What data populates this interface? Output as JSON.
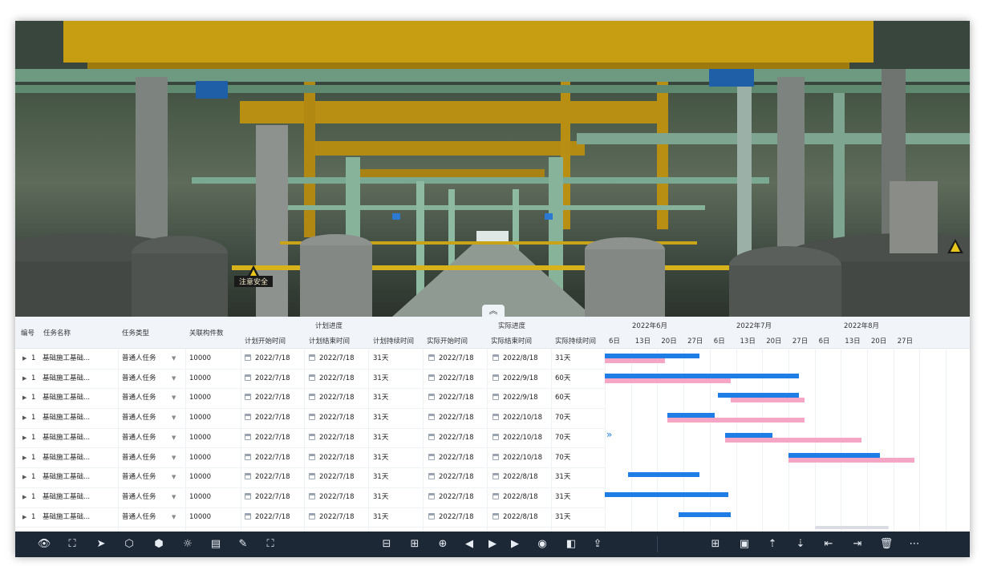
{
  "viewport": {
    "sign_text": "注意安全",
    "collapse_label": "︽"
  },
  "table": {
    "headers": {
      "id": "编号",
      "name": "任务名称",
      "type": "任务类型",
      "component": "关联构件数",
      "plan_group": "计划进度",
      "plan_start": "计划开始时间",
      "plan_end": "计划结束时间",
      "plan_duration": "计划持续时间",
      "actual_group": "实际进度",
      "actual_start": "实际开始时间",
      "actual_end": "实际结束时间",
      "actual_duration": "实际持续时间"
    },
    "rows": [
      {
        "id": "1",
        "name": "基础施工基础...",
        "type": "普通人任务",
        "component": "10000",
        "plan_start": "2022/7/18",
        "plan_end": "2022/7/18",
        "plan_duration": "31天",
        "actual_start": "2022/7/18",
        "actual_end": "2022/8/18",
        "actual_duration": "31天"
      },
      {
        "id": "1",
        "name": "基础施工基础...",
        "type": "普通人任务",
        "component": "10000",
        "plan_start": "2022/7/18",
        "plan_end": "2022/7/18",
        "plan_duration": "31天",
        "actual_start": "2022/7/18",
        "actual_end": "2022/9/18",
        "actual_duration": "60天"
      },
      {
        "id": "1",
        "name": "基础施工基础...",
        "type": "普通人任务",
        "component": "10000",
        "plan_start": "2022/7/18",
        "plan_end": "2022/7/18",
        "plan_duration": "31天",
        "actual_start": "2022/7/18",
        "actual_end": "2022/9/18",
        "actual_duration": "60天"
      },
      {
        "id": "1",
        "name": "基础施工基础...",
        "type": "普通人任务",
        "component": "10000",
        "plan_start": "2022/7/18",
        "plan_end": "2022/7/18",
        "plan_duration": "31天",
        "actual_start": "2022/7/18",
        "actual_end": "2022/10/18",
        "actual_duration": "70天"
      },
      {
        "id": "1",
        "name": "基础施工基础...",
        "type": "普通人任务",
        "component": "10000",
        "plan_start": "2022/7/18",
        "plan_end": "2022/7/18",
        "plan_duration": "31天",
        "actual_start": "2022/7/18",
        "actual_end": "2022/10/18",
        "actual_duration": "70天"
      },
      {
        "id": "1",
        "name": "基础施工基础...",
        "type": "普通人任务",
        "component": "10000",
        "plan_start": "2022/7/18",
        "plan_end": "2022/7/18",
        "plan_duration": "31天",
        "actual_start": "2022/7/18",
        "actual_end": "2022/10/18",
        "actual_duration": "70天"
      },
      {
        "id": "1",
        "name": "基础施工基础...",
        "type": "普通人任务",
        "component": "10000",
        "plan_start": "2022/7/18",
        "plan_end": "2022/7/18",
        "plan_duration": "31天",
        "actual_start": "2022/7/18",
        "actual_end": "2022/8/18",
        "actual_duration": "31天"
      },
      {
        "id": "1",
        "name": "基础施工基础...",
        "type": "普通人任务",
        "component": "10000",
        "plan_start": "2022/7/18",
        "plan_end": "2022/7/18",
        "plan_duration": "31天",
        "actual_start": "2022/7/18",
        "actual_end": "2022/8/18",
        "actual_duration": "31天"
      },
      {
        "id": "1",
        "name": "基础施工基础...",
        "type": "普通人任务",
        "component": "10000",
        "plan_start": "2022/7/18",
        "plan_end": "2022/7/18",
        "plan_duration": "31天",
        "actual_start": "2022/7/18",
        "actual_end": "2022/8/18",
        "actual_duration": "31天"
      }
    ]
  },
  "gantt": {
    "months": [
      "2022年6月",
      "2022年7月",
      "2022年8月"
    ],
    "days": [
      "6日",
      "13日",
      "20日",
      "27日",
      "6日",
      "13日",
      "20日",
      "27日",
      "6日",
      "13日",
      "20日",
      "27日"
    ],
    "plan_color": "#1e7ee6",
    "actual_color": "#f4a6c4",
    "bars": [
      {
        "plan": [
          0.0,
          3.6
        ],
        "actual": [
          0.0,
          2.3
        ]
      },
      {
        "plan": [
          0.0,
          7.4
        ],
        "actual": [
          0.0,
          4.8
        ]
      },
      {
        "plan": [
          4.3,
          7.4
        ],
        "actual": [
          4.8,
          7.6
        ]
      },
      {
        "plan": [
          2.4,
          4.2
        ],
        "actual": [
          2.4,
          7.6
        ]
      },
      {
        "plan": [
          4.6,
          6.4
        ],
        "actual": [
          4.6,
          9.8
        ]
      },
      {
        "plan": [
          7.0,
          10.5
        ],
        "actual": [
          7.0,
          11.8
        ]
      },
      {
        "plan": [
          0.9,
          3.6
        ],
        "actual": null
      },
      {
        "plan": [
          0.0,
          4.7
        ],
        "actual": null
      },
      {
        "plan": [
          2.8,
          4.8
        ],
        "actual": null
      }
    ]
  },
  "toolbar": {
    "left": [
      "eye-icon",
      "box-select-icon",
      "send-icon",
      "cube-icon",
      "cube-rotate-icon",
      "weather-icon",
      "building-icon",
      "document-edit-icon",
      "fullscreen-icon"
    ],
    "center": [
      "section-box-icon",
      "section-plane-icon",
      "globe-icon",
      "prev-icon",
      "play-icon",
      "next-icon",
      "camera-view-icon",
      "compare-icon",
      "export-icon"
    ],
    "right": [
      "add-icon",
      "add-child-icon",
      "move-up-icon",
      "move-down-icon",
      "outdent-icon",
      "indent-icon",
      "delete-icon",
      "more-icon"
    ]
  }
}
